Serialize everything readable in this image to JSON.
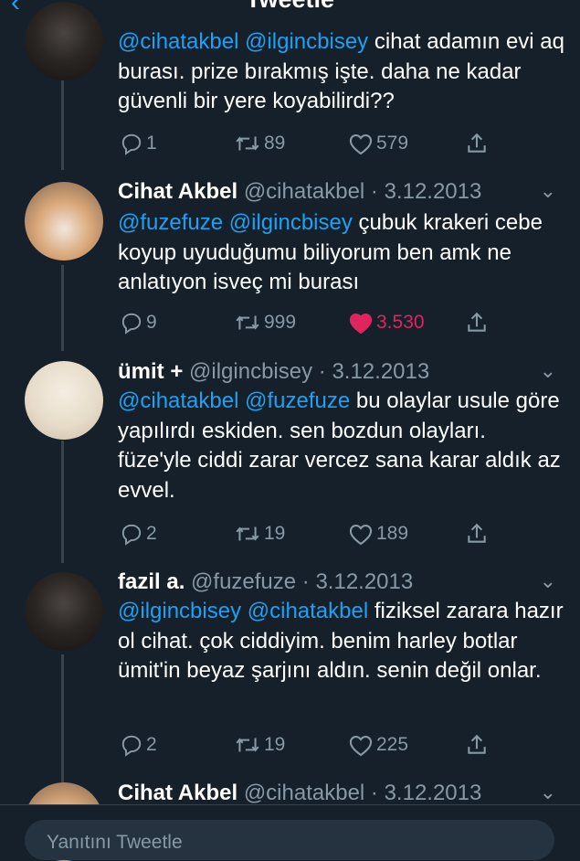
{
  "header": {
    "title": "Tweetle",
    "back_icon": "back-arrow-icon"
  },
  "tweets": [
    {
      "name": "",
      "handle": "",
      "date": "",
      "body_mentions": "@cihatakbel @ilgincbisey",
      "body_text": " cihat adamın evi aq burası. prize bırakmış işte. daha ne kadar güvenli bir yere koyabilirdi??",
      "replies": "1",
      "retweets": "89",
      "likes": "579",
      "liked": false
    },
    {
      "name": "Cihat Akbel",
      "handle": "@cihatakbel",
      "date": "3.12.2013",
      "body_mentions": "@fuzefuze @ilgincbisey",
      "body_text": " çubuk krakeri cebe koyup uyuduğumu biliyorum ben amk ne anlatıyon isveç mi burası",
      "replies": "9",
      "retweets": "999",
      "likes": "3.530",
      "liked": true
    },
    {
      "name": "ümit +",
      "handle": "@ilgincbisey",
      "date": "3.12.2013",
      "body_mentions": "@cihatakbel @fuzefuze",
      "body_text": " bu olaylar usule göre yapılırdı eskiden. sen bozdun olayları. füze'yle ciddi zarar vercez sana karar aldık az evvel.",
      "replies": "2",
      "retweets": "19",
      "likes": "189",
      "liked": false
    },
    {
      "name": "fazil a.",
      "handle": "@fuzefuze",
      "date": "3.12.2013",
      "body_mentions": "@ilgincbisey @cihatakbel",
      "body_text": " fiziksel zarara hazır ol cihat. çok ciddiyim. benim harley botlar ümit'in beyaz şarjını aldın. senin değil onlar.",
      "replies": "2",
      "retweets": "19",
      "likes": "225",
      "liked": false
    },
    {
      "name": "Cihat Akbel",
      "handle": "@cihatakbel",
      "date": "3.12.2013"
    }
  ],
  "compose": {
    "placeholder": "Yanıtını Tweetle"
  },
  "colors": {
    "background": "#15202b",
    "accent": "#1da1f2",
    "muted": "#8899a6",
    "like": "#e0245e",
    "thread_line": "#38444d"
  }
}
